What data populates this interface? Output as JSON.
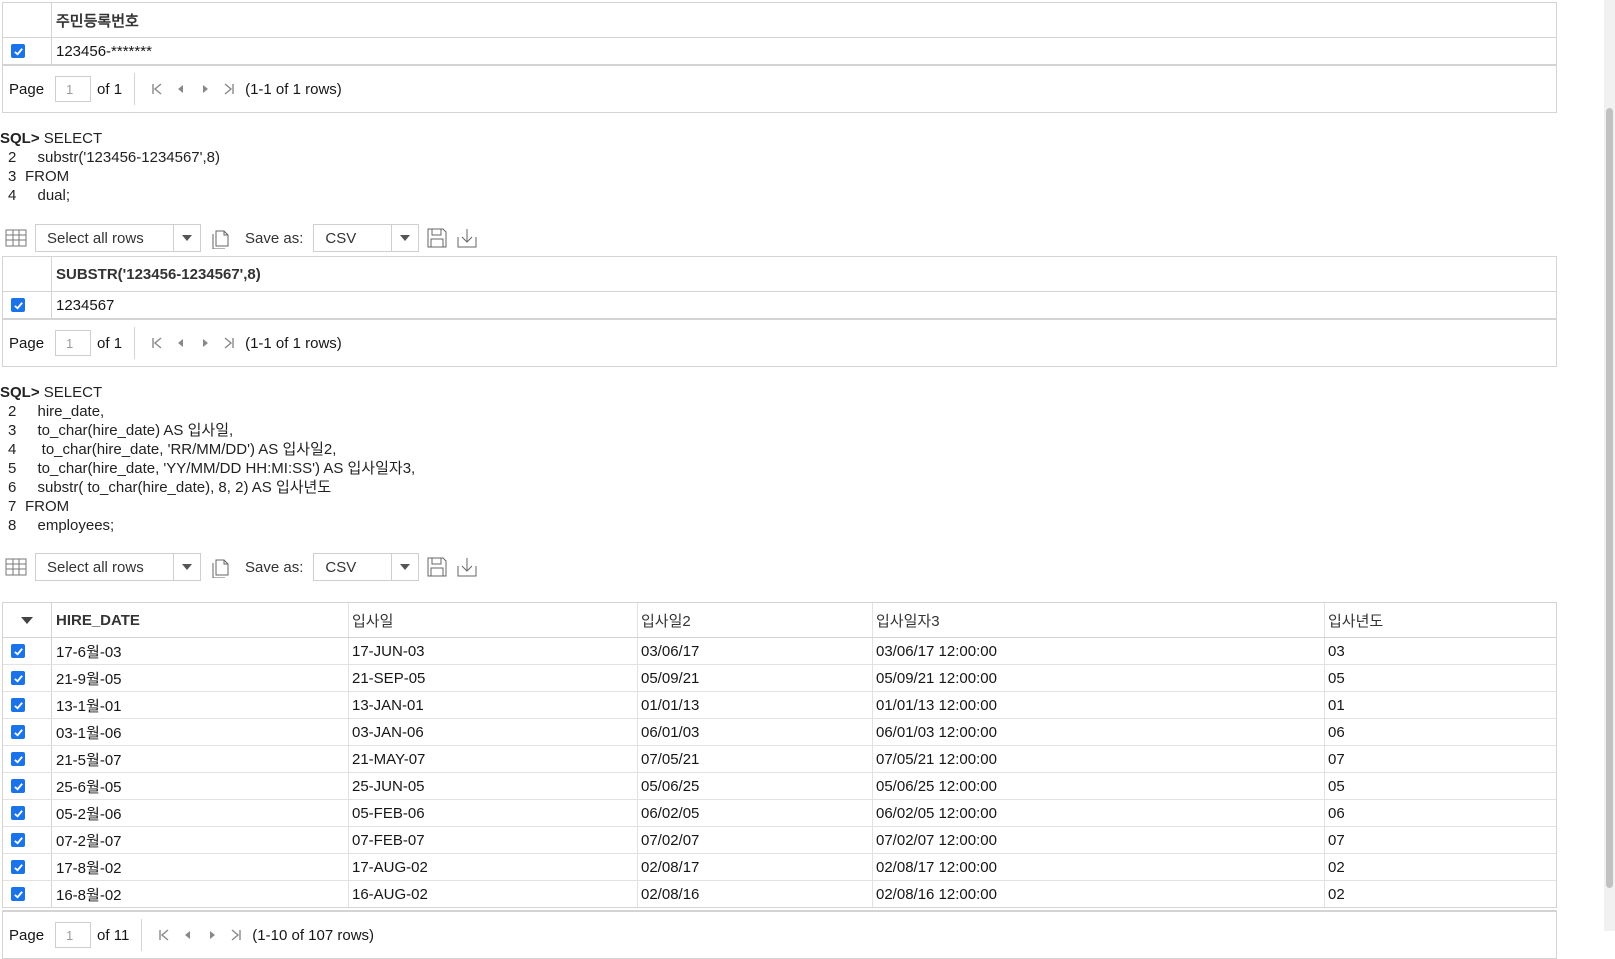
{
  "grid1": {
    "columns": [
      "주민등록번호"
    ],
    "rows": [
      [
        "123456-*******"
      ]
    ]
  },
  "pager1": {
    "page_label": "Page",
    "page_value": "1",
    "of_label": "of 1",
    "rows_label": "(1-1 of 1 rows)"
  },
  "query2": {
    "prompt": "SQL>",
    "lines": [
      {
        "num": "",
        "text": "SELECT"
      },
      {
        "num": "2",
        "text": "   substr('123456-1234567',8)"
      },
      {
        "num": "3",
        "text": "FROM"
      },
      {
        "num": "4",
        "text": "   dual;"
      }
    ]
  },
  "toolbar2": {
    "select_label": "Select all rows",
    "save_as_label": "Save as:",
    "format_value": "CSV"
  },
  "grid2": {
    "columns": [
      "SUBSTR('123456-1234567',8)"
    ],
    "rows": [
      [
        "1234567"
      ]
    ]
  },
  "pager2": {
    "page_label": "Page",
    "page_value": "1",
    "of_label": "of 1",
    "rows_label": "(1-1 of 1 rows)"
  },
  "query3": {
    "prompt": "SQL>",
    "lines": [
      {
        "num": "",
        "text": "SELECT"
      },
      {
        "num": "2",
        "text": "   hire_date,"
      },
      {
        "num": "3",
        "text": "   to_char(hire_date) AS 입사일,"
      },
      {
        "num": "4",
        "text": "    to_char(hire_date, 'RR/MM/DD') AS 입사일2,"
      },
      {
        "num": "5",
        "text": "   to_char(hire_date, 'YY/MM/DD HH:MI:SS') AS 입사일자3,"
      },
      {
        "num": "6",
        "text": "   substr( to_char(hire_date), 8, 2) AS 입사년도"
      },
      {
        "num": "7",
        "text": "FROM"
      },
      {
        "num": "8",
        "text": "   employees;"
      }
    ]
  },
  "toolbar3": {
    "select_label": "Select all rows",
    "save_as_label": "Save as:",
    "format_value": "CSV"
  },
  "grid3": {
    "columns": [
      "HIRE_DATE",
      "입사일",
      "입사일2",
      "입사일자3",
      "입사년도"
    ],
    "rows": [
      [
        "17-6월-03",
        "17-JUN-03",
        "03/06/17",
        "03/06/17 12:00:00",
        "03"
      ],
      [
        "21-9월-05",
        "21-SEP-05",
        "05/09/21",
        "05/09/21 12:00:00",
        "05"
      ],
      [
        "13-1월-01",
        "13-JAN-01",
        "01/01/13",
        "01/01/13 12:00:00",
        "01"
      ],
      [
        "03-1월-06",
        "03-JAN-06",
        "06/01/03",
        "06/01/03 12:00:00",
        "06"
      ],
      [
        "21-5월-07",
        "21-MAY-07",
        "07/05/21",
        "07/05/21 12:00:00",
        "07"
      ],
      [
        "25-6월-05",
        "25-JUN-05",
        "05/06/25",
        "05/06/25 12:00:00",
        "05"
      ],
      [
        "05-2월-06",
        "05-FEB-06",
        "06/02/05",
        "06/02/05 12:00:00",
        "06"
      ],
      [
        "07-2월-07",
        "07-FEB-07",
        "07/02/07",
        "07/02/07 12:00:00",
        "07"
      ],
      [
        "17-8월-02",
        "17-AUG-02",
        "02/08/17",
        "02/08/17 12:00:00",
        "02"
      ],
      [
        "16-8월-02",
        "16-AUG-02",
        "02/08/16",
        "02/08/16 12:00:00",
        "02"
      ]
    ]
  },
  "pager3": {
    "page_label": "Page",
    "page_value": "1",
    "of_label": "of 11",
    "rows_label": "(1-10 of 107 rows)"
  }
}
